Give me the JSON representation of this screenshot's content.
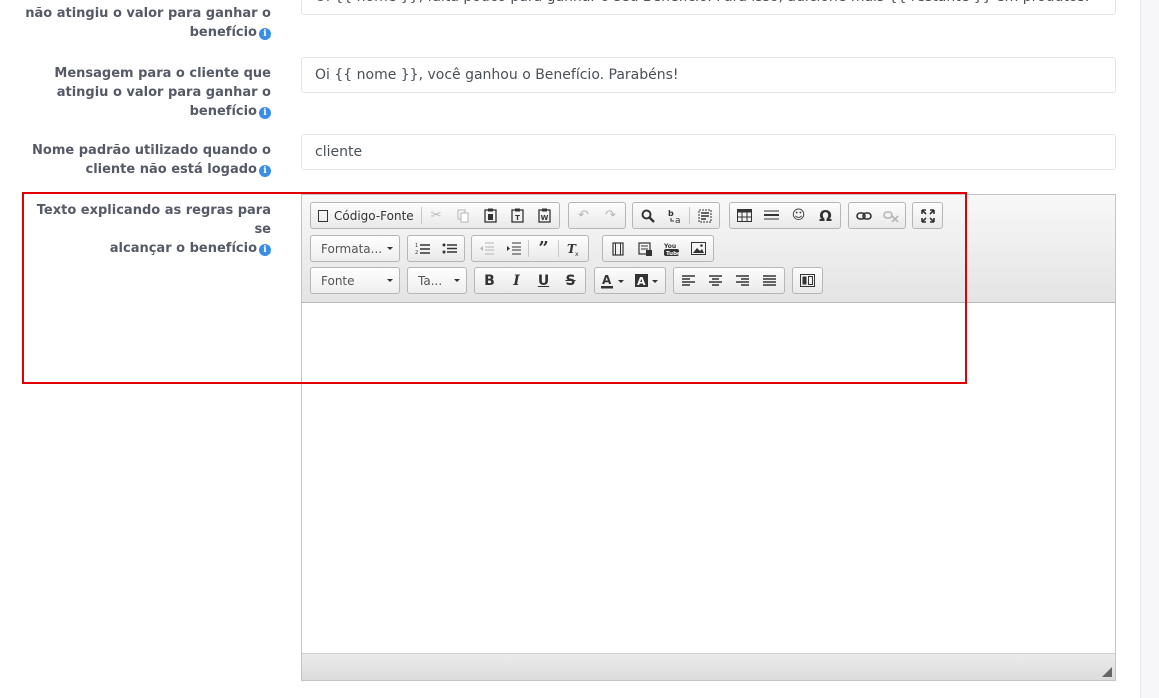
{
  "fields": [
    {
      "label_lines": [
        "",
        "não atingiu o valor para ganhar o",
        "benefício"
      ],
      "value": "Oi {{ nome }}, falta pouco para ganhar o seu Benefício. Para isso, adicione mais {{ restante }} em produtos."
    },
    {
      "label_lines": [
        "Mensagem para o cliente que",
        "atingiu o valor para ganhar o",
        "benefício"
      ],
      "value": "Oi {{ nome }}, você ganhou o Benefício. Parabéns!"
    },
    {
      "label_lines": [
        "Nome padrão utilizado quando o",
        "cliente não está logado"
      ],
      "value": "cliente"
    },
    {
      "label_lines": [
        "Texto explicando as regras para se",
        "alcançar o benefício"
      ],
      "value": ""
    }
  ],
  "info_icon_glyph": "i",
  "editor": {
    "source_button_label": "Código-Fonte",
    "format_combo": "Formata...",
    "font_combo": "Fonte",
    "size_combo": "Ta...",
    "body_text": ""
  },
  "colors": {
    "info_icon": "#3a8ee6",
    "highlight": "#e00000",
    "label": "#555a66"
  }
}
